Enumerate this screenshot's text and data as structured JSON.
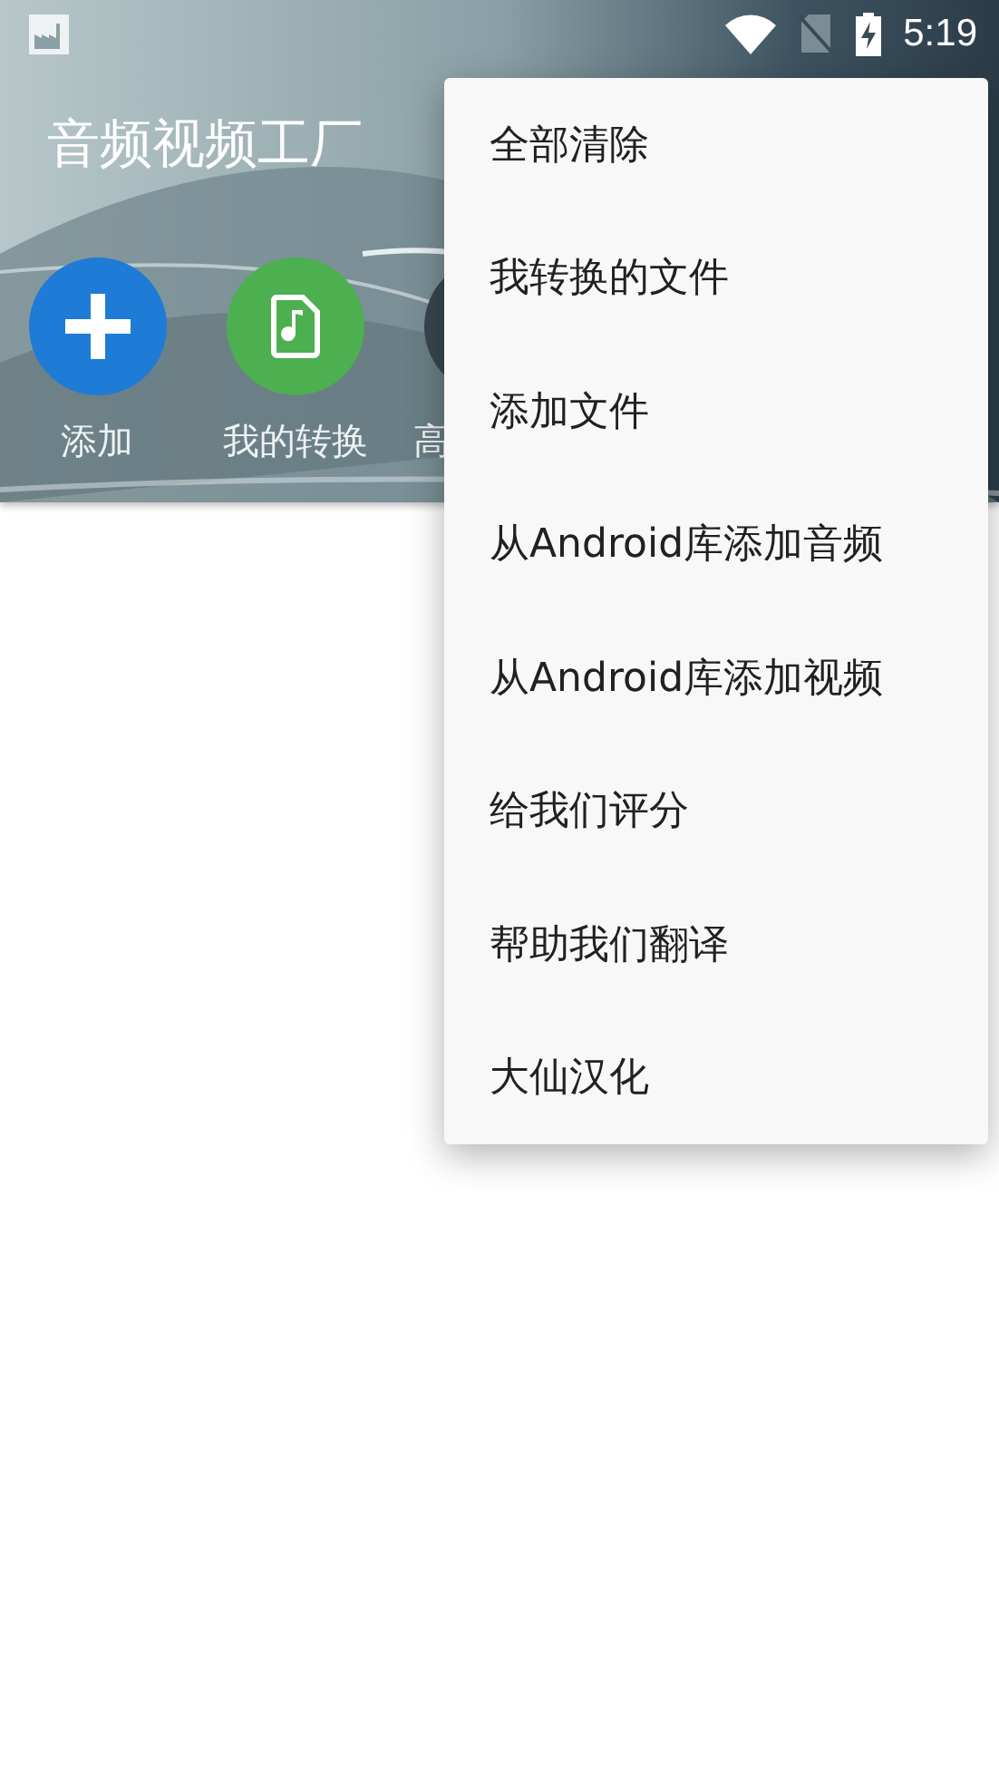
{
  "status_bar": {
    "time": "5:19"
  },
  "app_bar": {
    "title": "音频视频工厂"
  },
  "actions": [
    {
      "kind": "add",
      "label": "添加"
    },
    {
      "kind": "converted",
      "label": "我的转换"
    },
    {
      "kind": "dark",
      "label": "高"
    }
  ],
  "menu": {
    "items": [
      {
        "label": "全部清除"
      },
      {
        "label": "我转换的文件"
      },
      {
        "label": "添加文件"
      },
      {
        "label": "从Android库添加音频"
      },
      {
        "label": "从Android库添加视频"
      },
      {
        "label": "给我们评分"
      },
      {
        "label": "帮助我们翻译"
      },
      {
        "label": "大仙汉化"
      }
    ]
  }
}
